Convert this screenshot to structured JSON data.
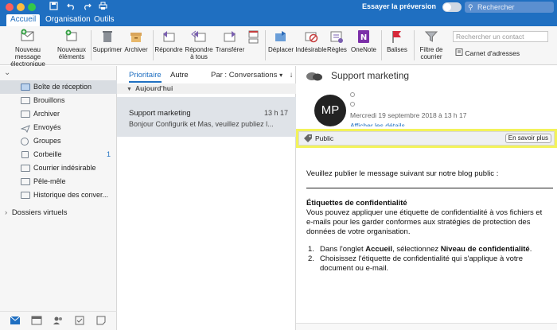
{
  "titlebar": {
    "try_preview": "Essayer la préversion",
    "search_placeholder": "Rechercher"
  },
  "tabs": [
    "Accueil",
    "Organisation",
    "Outils"
  ],
  "ribbon": {
    "new_email": [
      "Nouveau message",
      "électronique"
    ],
    "new_items": [
      "Nouveaux",
      "éléments"
    ],
    "delete": "Supprimer",
    "archive": "Archiver",
    "reply": "Répondre",
    "reply_all": [
      "Répondre",
      "à tous"
    ],
    "forward": "Transférer",
    "move": "Déplacer",
    "junk": "Indésirable",
    "rules": "Règles",
    "onenote": "OneNote",
    "flags": "Balises",
    "filter_mail": [
      "Filtre de",
      "courrier"
    ],
    "contact_search_placeholder": "Rechercher un contact",
    "address_book": "Carnet d'adresses"
  },
  "sidebar": {
    "folders": [
      {
        "label": "Boîte de réception",
        "count": ""
      },
      {
        "label": "Brouillons",
        "count": ""
      },
      {
        "label": "Archiver",
        "count": ""
      },
      {
        "label": "Envoyés",
        "count": ""
      },
      {
        "label": "Groupes",
        "count": ""
      },
      {
        "label": "Corbeille",
        "count": "1"
      },
      {
        "label": "Courrier indésirable",
        "count": ""
      },
      {
        "label": "Pêle-mêle",
        "count": ""
      },
      {
        "label": "Historique des conver...",
        "count": ""
      }
    ],
    "virtual_folders": "Dossiers virtuels"
  },
  "list": {
    "tab_focused": "Prioritaire",
    "tab_other": "Autre",
    "sort": "Par : Conversations",
    "group_header": "Aujourd'hui",
    "message": {
      "from": "Support marketing",
      "time": "13 h 17",
      "preview": "Bonjour Configurik et Mas, veuillez publiez l..."
    }
  },
  "reading": {
    "subject": "Support marketing",
    "avatar_initials": "MP",
    "date": "Mercredi 19 septembre 2018 à 13 h 17",
    "more_details": "Afficher les détails",
    "sensitivity_label": "Public",
    "learn_more": "En savoir plus",
    "intro": "Veuillez publier le message suivant sur notre blog public :",
    "heading": "Étiquettes de confidentialité",
    "paragraph": "Vous pouvez appliquer une étiquette de confidentialité à vos fichiers et e-mails pour les garder conformes aux stratégies de protection des données de votre organisation.",
    "step1_prefix": "Dans l'onglet ",
    "step1_bold1": "Accueil",
    "step1_mid": ", sélectionnez ",
    "step1_bold2": "Niveau de confidentialité",
    "step1_suffix": ".",
    "step2": "Choisissez l'étiquette de confidentialité qui s'applique à votre document ou e-mail."
  },
  "colors": {
    "accent": "#1f6fc1",
    "highlight": "#f3f35a",
    "selected_row": "#dfe3e8"
  }
}
